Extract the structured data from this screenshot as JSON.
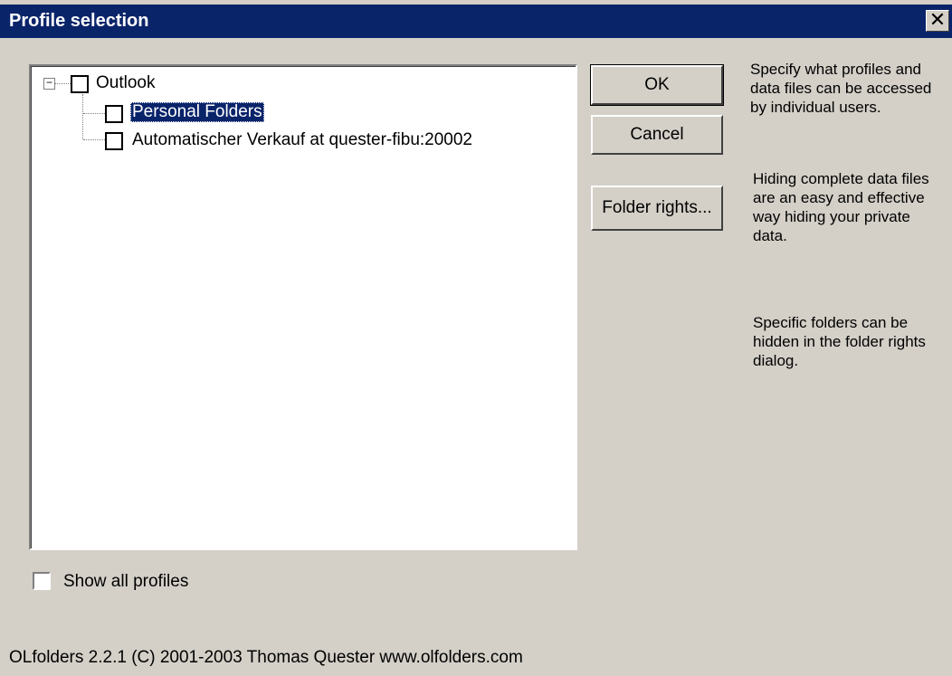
{
  "window": {
    "title": "Profile selection",
    "close_glyph": "✕"
  },
  "tree": {
    "root": {
      "label": "Outlook",
      "expander": "−",
      "checked": false
    },
    "children": [
      {
        "label": "Personal Folders",
        "checked": false,
        "selected": true
      },
      {
        "label": "Automatischer Verkauf at quester-fibu:20002",
        "checked": false,
        "selected": false
      }
    ]
  },
  "buttons": {
    "ok": "OK",
    "cancel": "Cancel",
    "folder_rights": "Folder rights..."
  },
  "help": {
    "para1": "Specify what profiles and data files can be accessed by individual users.",
    "para2": "Hiding complete data files are an easy and effective way hiding your private data.",
    "para3": "Specific folders can be hidden in the folder rights dialog."
  },
  "show_all_profiles": {
    "label": "Show all profiles",
    "checked": false
  },
  "footer": "OLfolders 2.2.1 (C) 2001-2003 Thomas Quester www.olfolders.com",
  "colors": {
    "titlebar": "#0a246a",
    "dialog_bg": "#d4d0c8",
    "selection": "#0a246a"
  }
}
